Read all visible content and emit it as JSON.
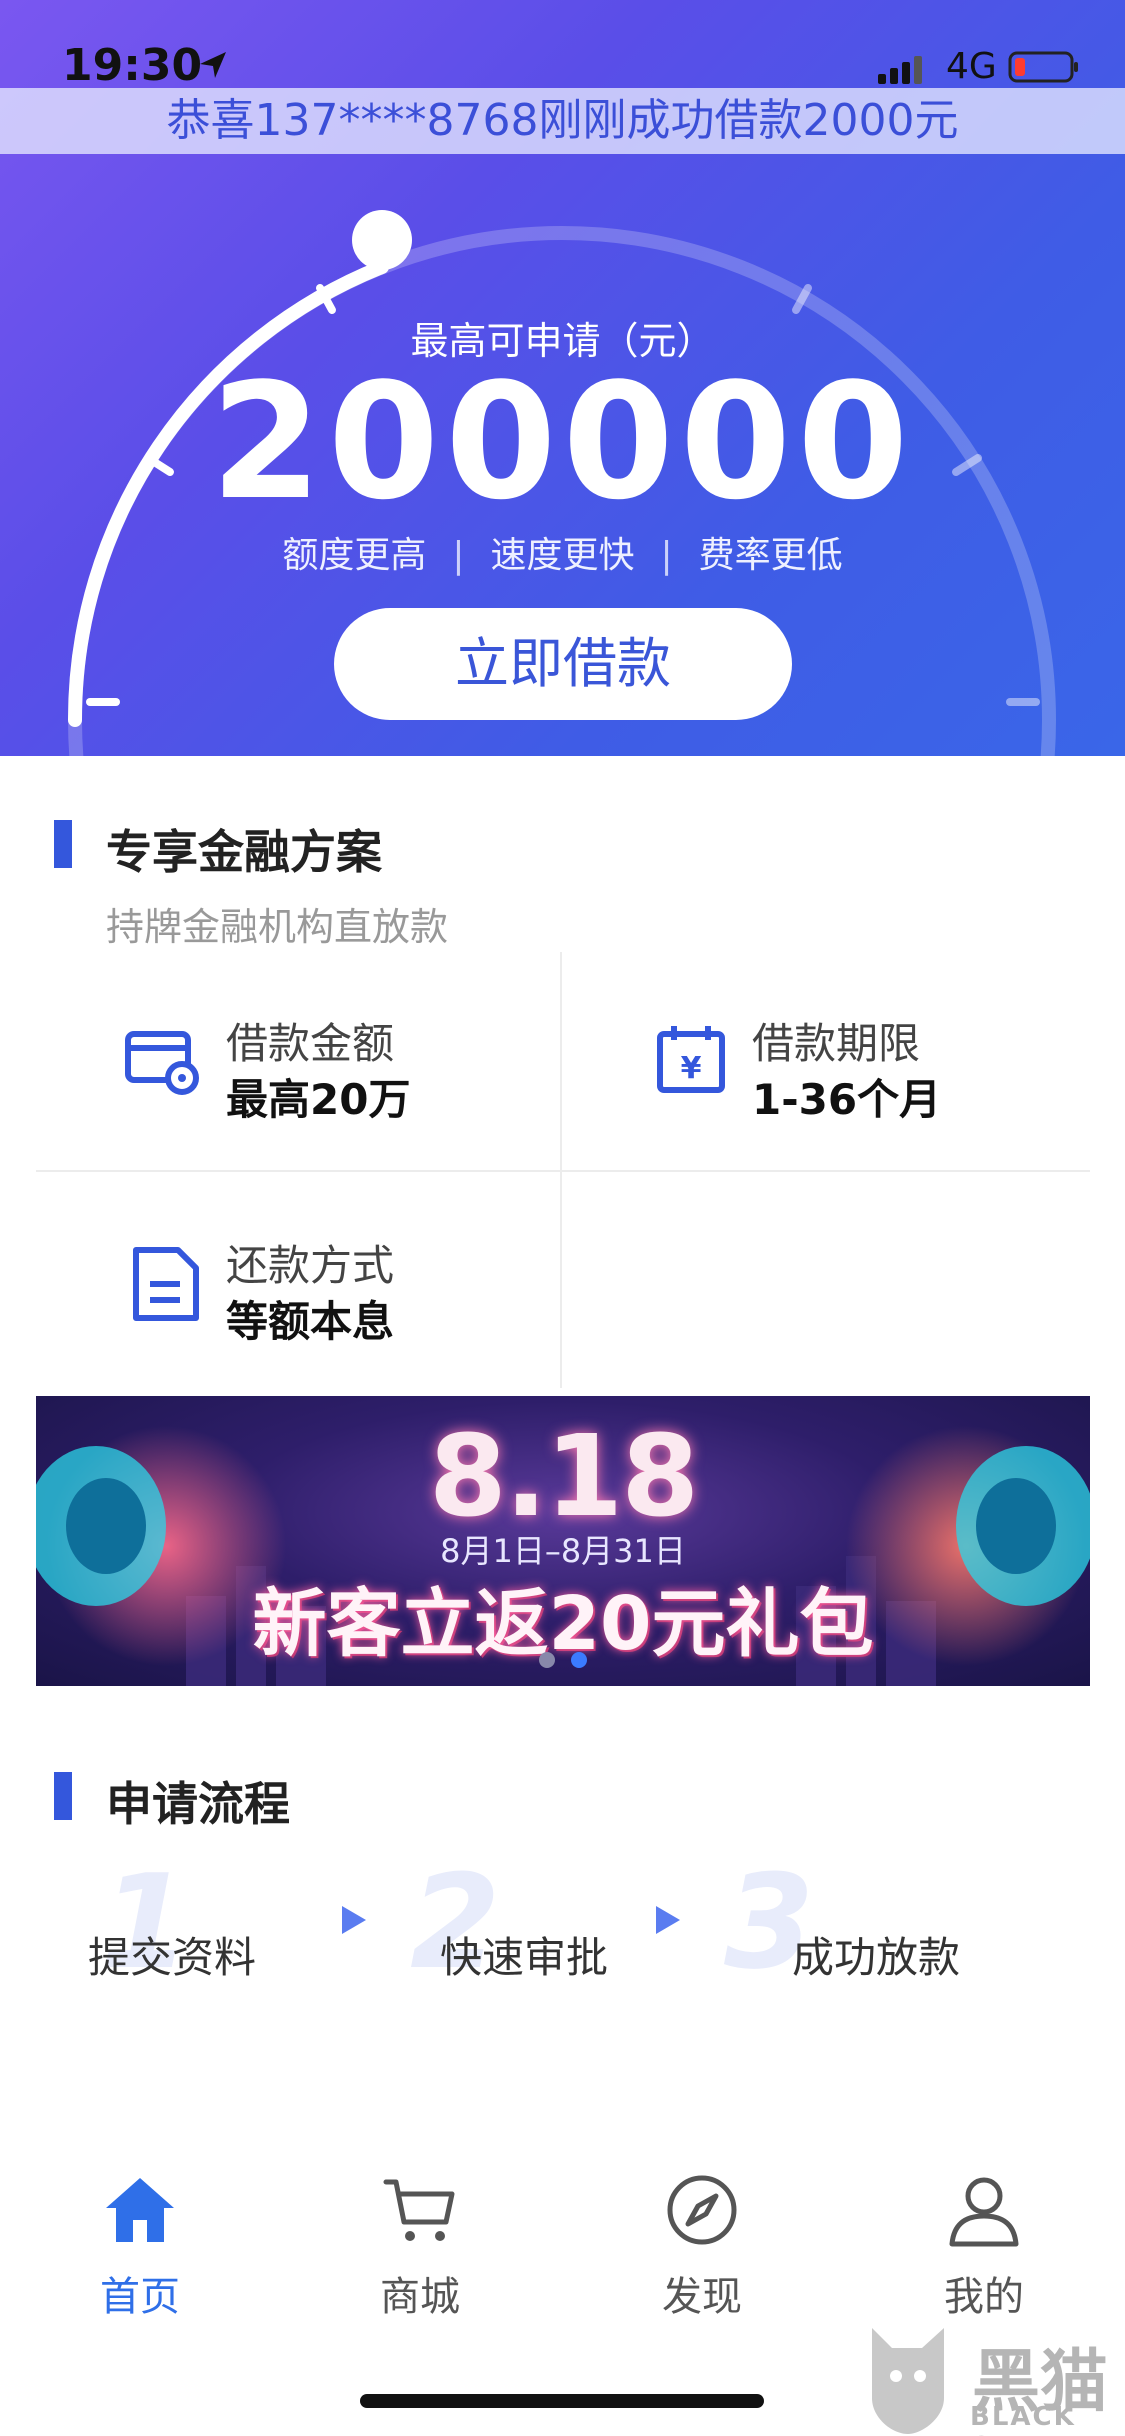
{
  "status_bar": {
    "time": "19:30",
    "network": "4G"
  },
  "ticker": {
    "text": "恭喜137****8768刚刚成功借款2000元"
  },
  "hero": {
    "label": "最高可申请（元）",
    "amount": "200000",
    "features": [
      "额度更高",
      "速度更快",
      "费率更低"
    ],
    "separator": "|",
    "button_label": "立即借款"
  },
  "finance": {
    "title": "专享金融方案",
    "subtitle": "持牌金融机构直放款",
    "items": [
      {
        "label": "借款金额",
        "value": "最高20万",
        "icon": "card-icon"
      },
      {
        "label": "借款期限",
        "value": "1-36个月",
        "icon": "calendar-yen-icon"
      },
      {
        "label": "还款方式",
        "value": "等额本息",
        "icon": "document-icon"
      }
    ]
  },
  "banner": {
    "title": "8.18",
    "dates": "8月1日–8月31日",
    "promo": "新客立返20元礼包",
    "dots_total": 2,
    "dots_active": 2
  },
  "process": {
    "title": "申请流程",
    "steps": [
      {
        "num": "1",
        "label": "提交资料"
      },
      {
        "num": "2",
        "label": "快速审批"
      },
      {
        "num": "3",
        "label": "成功放款"
      }
    ]
  },
  "tabbar": {
    "items": [
      {
        "label": "首页",
        "icon": "home-icon",
        "active": true
      },
      {
        "label": "商城",
        "icon": "cart-icon",
        "active": false
      },
      {
        "label": "发现",
        "icon": "compass-icon",
        "active": false
      },
      {
        "label": "我的",
        "icon": "user-icon",
        "active": false
      }
    ]
  },
  "watermark": {
    "text": "黑猫",
    "sub": "BLACK CAT"
  },
  "colors": {
    "accent": "#3457dc",
    "tab_active": "#2f6fe8",
    "hero_start": "#7a57f0",
    "hero_end": "#3a66e8"
  }
}
